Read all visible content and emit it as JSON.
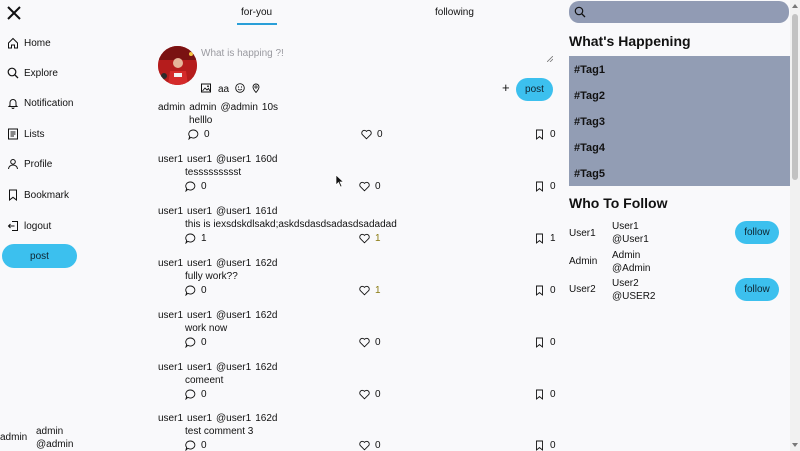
{
  "sidebar": {
    "items": [
      {
        "label": "Home",
        "icon": "home-icon"
      },
      {
        "label": "Explore",
        "icon": "search-icon"
      },
      {
        "label": "Notification",
        "icon": "bell-icon"
      },
      {
        "label": "Lists",
        "icon": "list-icon"
      },
      {
        "label": "Profile",
        "icon": "person-icon"
      },
      {
        "label": "Bookmark",
        "icon": "bookmark-icon"
      },
      {
        "label": "logout",
        "icon": "logout-icon"
      }
    ],
    "post_label": "post",
    "current_user": {
      "name": "admin",
      "display": "admin",
      "handle": "@admin"
    }
  },
  "tabs": [
    {
      "label": "for-you",
      "active": true
    },
    {
      "label": "following",
      "active": false
    }
  ],
  "composer": {
    "placeholder": "What is happing ?!",
    "text_tool_label": "aa",
    "plus_label": "+",
    "post_label": "post"
  },
  "feed": [
    {
      "user": "admin",
      "display": "admin",
      "handle": "@admin",
      "time": "10s",
      "text": "helllo",
      "comments": "0",
      "likes": "0",
      "bookmarks": "0"
    },
    {
      "user": "user1",
      "display": "user1",
      "handle": "@user1",
      "time": "160d",
      "text": "tessssssssst",
      "comments": "0",
      "likes": "0",
      "bookmarks": "0"
    },
    {
      "user": "user1",
      "display": "user1",
      "handle": "@user1",
      "time": "161d",
      "text": "this is iexsdskdlsakd;askdsdasdsadasdsadadad",
      "comments": "1",
      "likes": "1",
      "bookmarks": "1"
    },
    {
      "user": "user1",
      "display": "user1",
      "handle": "@user1",
      "time": "162d",
      "text": "fully work??",
      "comments": "0",
      "likes": "1",
      "bookmarks": "0"
    },
    {
      "user": "user1",
      "display": "user1",
      "handle": "@user1",
      "time": "162d",
      "text": "work now",
      "comments": "0",
      "likes": "0",
      "bookmarks": "0"
    },
    {
      "user": "user1",
      "display": "user1",
      "handle": "@user1",
      "time": "162d",
      "text": "comeent",
      "comments": "0",
      "likes": "0",
      "bookmarks": "0"
    },
    {
      "user": "user1",
      "display": "user1",
      "handle": "@user1",
      "time": "162d",
      "text": "test comment 3",
      "comments": "0",
      "likes": "0",
      "bookmarks": "0"
    }
  ],
  "right": {
    "search_placeholder": "",
    "happening_title": "What's Happening",
    "trends": [
      "#Tag1",
      "#Tag2",
      "#Tag3",
      "#Tag4",
      "#Tag5"
    ],
    "who_title": "Who To Follow",
    "suggestions": [
      {
        "name": "User1",
        "display": "User1",
        "handle": "@User1",
        "follow_label": "follow"
      },
      {
        "name": "Admin",
        "display": "Admin",
        "handle": "@Admin",
        "follow_label": ""
      },
      {
        "name": "User2",
        "display": "User2",
        "handle": "@USER2",
        "follow_label": "follow"
      }
    ]
  },
  "colors": {
    "accent": "#3cc0ee",
    "panel": "#929db4",
    "tab_underline": "#2a9fd8",
    "highlight_count": "#8a7a10"
  }
}
